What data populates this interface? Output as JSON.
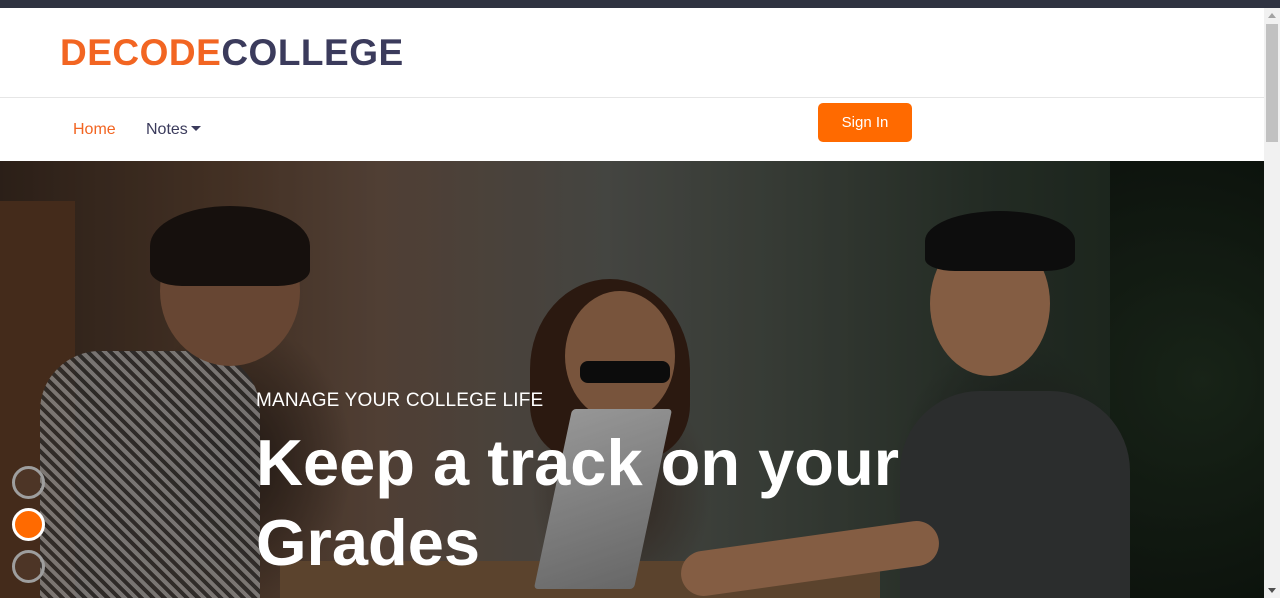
{
  "brand": {
    "part_a": "DECODE",
    "part_b": "COLLEGE"
  },
  "nav": {
    "items": [
      {
        "label": "Home",
        "active": true
      },
      {
        "label": "Notes",
        "dropdown": true
      }
    ],
    "signin_label": "Sign In"
  },
  "hero": {
    "subtitle": "MANAGE YOUR COLLEGE LIFE",
    "title": "Keep a track on your Grades",
    "slides": 3,
    "active_slide": 2
  },
  "colors": {
    "accent": "#ff6a00",
    "brand_orange": "#f26522",
    "brand_dark": "#3b3b5c",
    "top_strip": "#2f3341"
  },
  "icons": [
    "caret-down-icon",
    "scroll-up-arrow-icon",
    "scroll-down-arrow-icon"
  ]
}
